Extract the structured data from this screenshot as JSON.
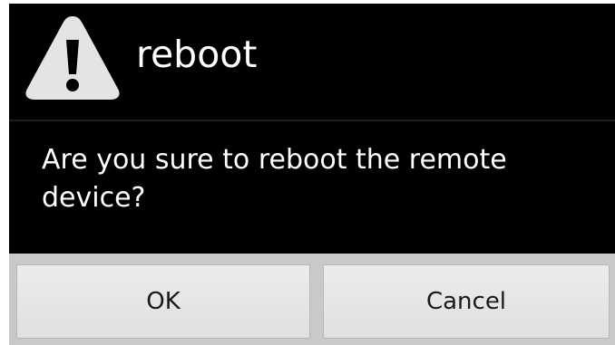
{
  "dialog": {
    "title": "reboot",
    "icon": "warning-icon",
    "message": "Are you sure to reboot the remote device?",
    "buttons": {
      "ok_label": "OK",
      "cancel_label": "Cancel"
    }
  },
  "colors": {
    "dialog_background": "#000000",
    "text": "#ffffff",
    "button_bar": "#c9c9c9",
    "button": "#e6e6e6",
    "icon": "#e4e4e4"
  }
}
